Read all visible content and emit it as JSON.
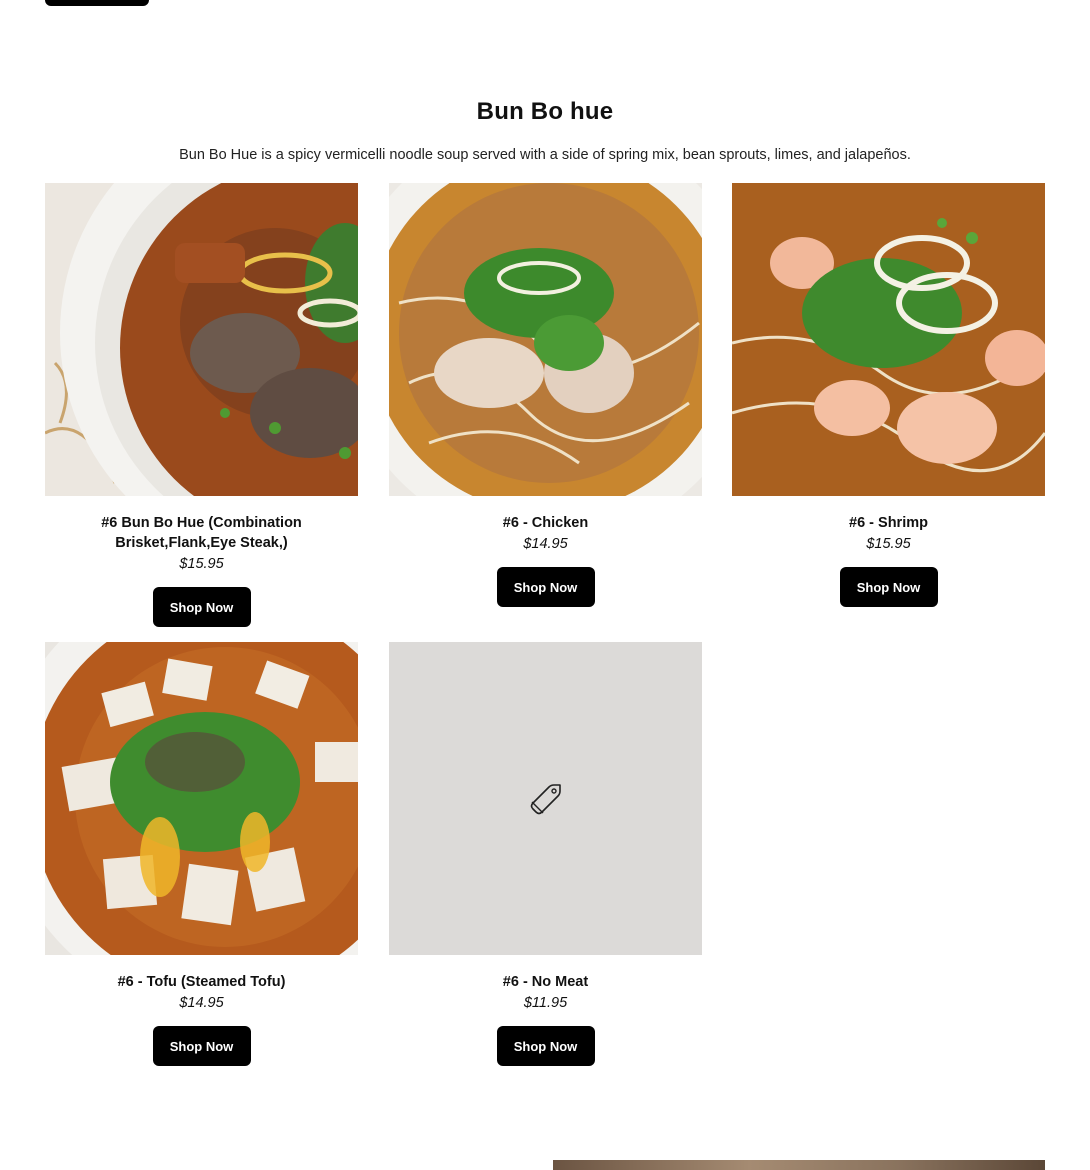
{
  "section": {
    "title": "Bun Bo hue",
    "description": "Bun Bo Hue is a spicy vermicelli noodle soup served with a side of spring mix, bean sprouts, limes, and jalapeños."
  },
  "products": [
    {
      "name": "#6 Bun Bo Hue (Combination Brisket,Flank,Eye Steak,)",
      "price": "$15.95",
      "button": "Shop Now",
      "image": "beef-noodle-soup-photo"
    },
    {
      "name": "#6 - Chicken",
      "price": "$14.95",
      "button": "Shop Now",
      "image": "chicken-noodle-soup-photo"
    },
    {
      "name": "#6 - Shrimp",
      "price": "$15.95",
      "button": "Shop Now",
      "image": "shrimp-noodle-soup-photo"
    },
    {
      "name": "#6 - Tofu (Steamed Tofu)",
      "price": "$14.95",
      "button": "Shop Now",
      "image": "tofu-noodle-soup-photo"
    },
    {
      "name": "#6 - No Meat",
      "price": "$11.95",
      "button": "Shop Now",
      "image": "tag-icon-placeholder"
    }
  ],
  "colors": {
    "button_bg": "#000000",
    "placeholder_bg": "#dcdad8"
  }
}
